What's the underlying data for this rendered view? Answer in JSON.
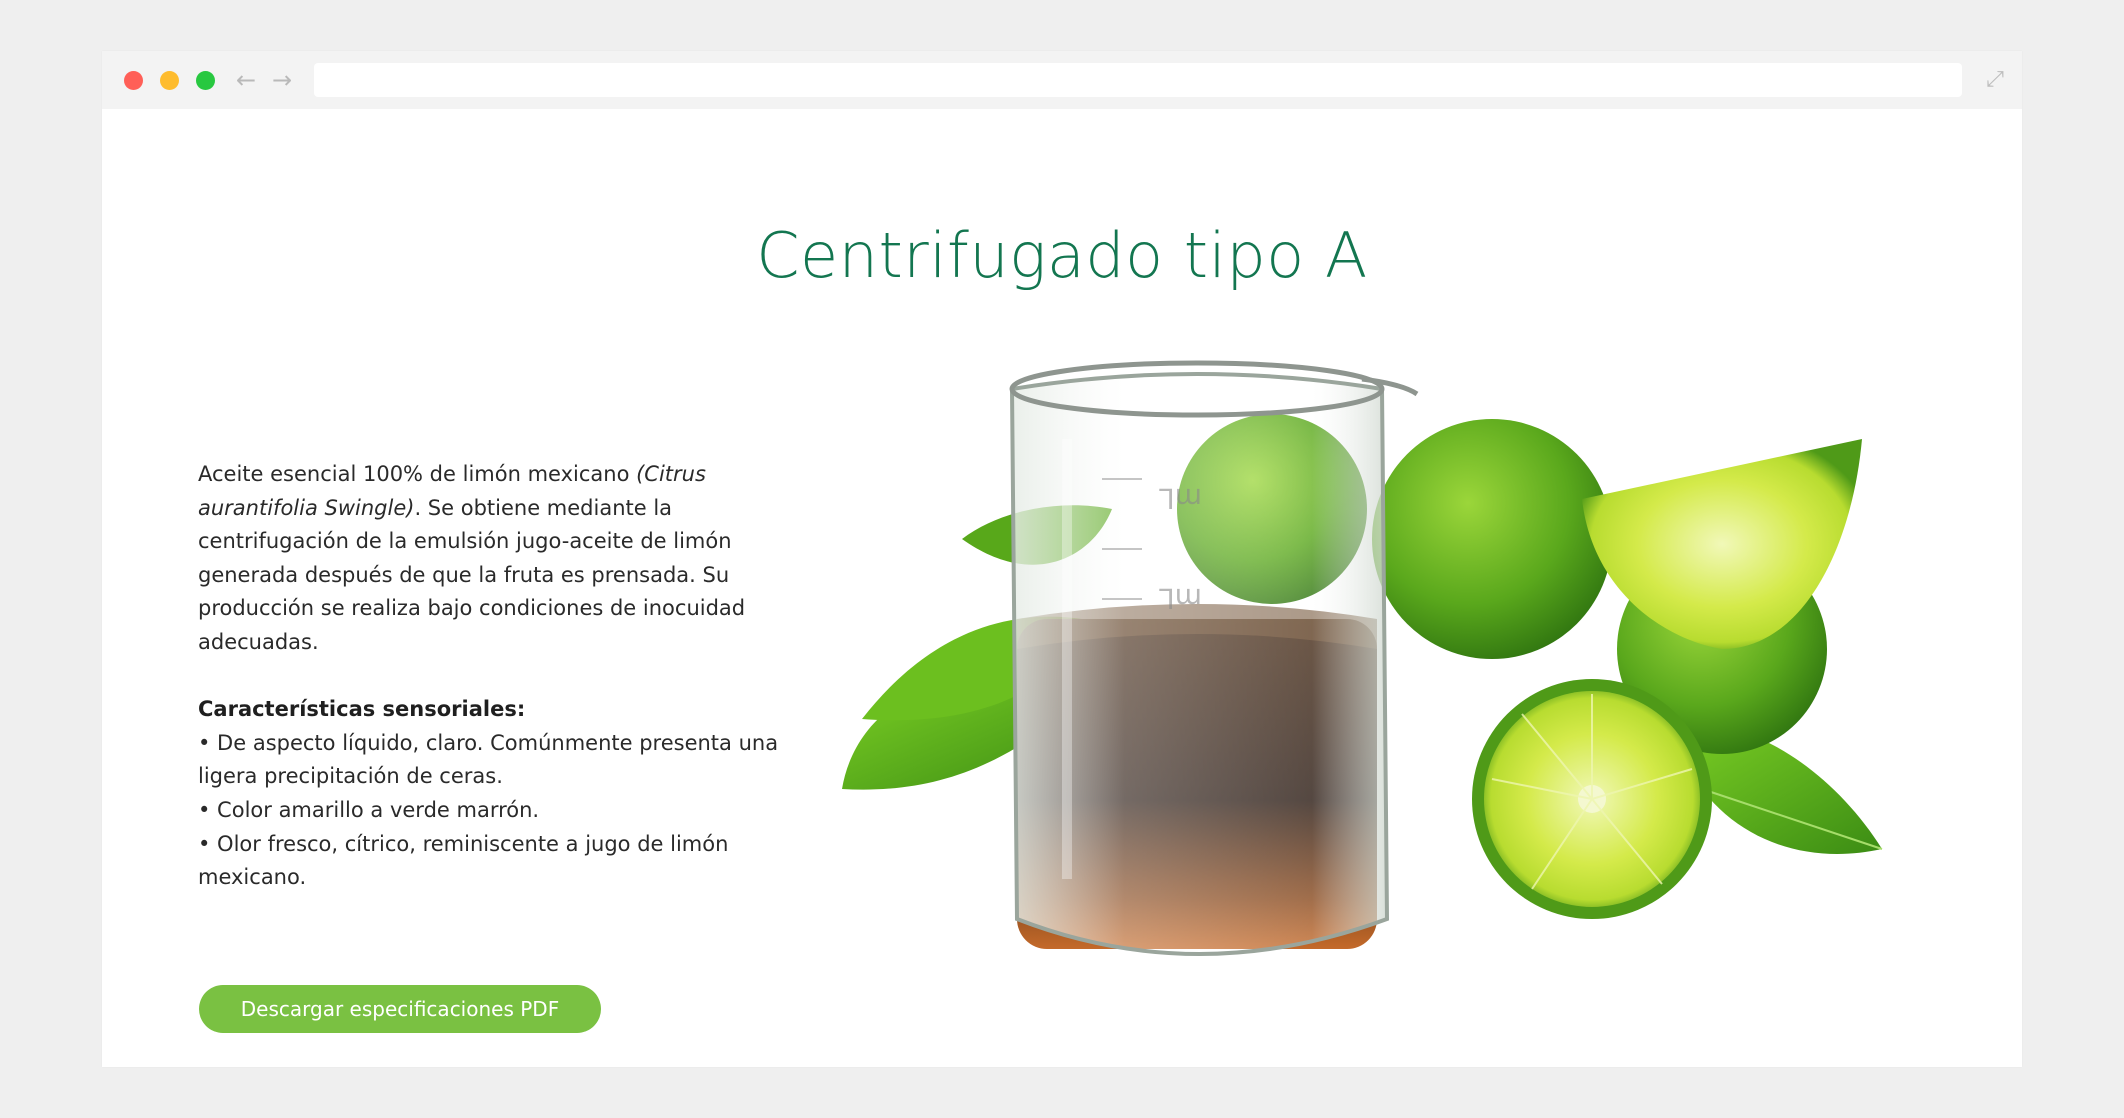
{
  "browser": {
    "back_icon": "arrow-left-icon",
    "forward_icon": "arrow-right-icon",
    "expand_icon": "expand-icon",
    "traffic_light_colors": [
      "#ff5f57",
      "#febc2e",
      "#28c840"
    ]
  },
  "page": {
    "title": "Centrifugado tipo A",
    "description": {
      "intro_before": "Aceite esencial 100% de limón mexicano ",
      "intro_italic": "(Citrus aurantifolia Swingle)",
      "intro_after": ". Se obtiene mediante la centrifugación de la emulsión jugo-aceite de limón generada después de que la fruta es prensada. Su producción se realiza bajo condiciones de inocuidad adecuadas.",
      "characteristics_heading": "Características sensoriales:",
      "characteristics": [
        "• De aspecto líquido, claro. Comúnmente presenta una ligera precipitación de ceras.",
        "• Color amarillo a verde marrón.",
        "• Olor fresco, cítrico, reminiscente a jugo de limón mexicano."
      ]
    },
    "download_button_label": "Descargar especificaciones PDF",
    "image_alt": "beaker-with-essential-oil-and-limes",
    "colors": {
      "title": "#137650",
      "button": "#7ac142"
    }
  }
}
